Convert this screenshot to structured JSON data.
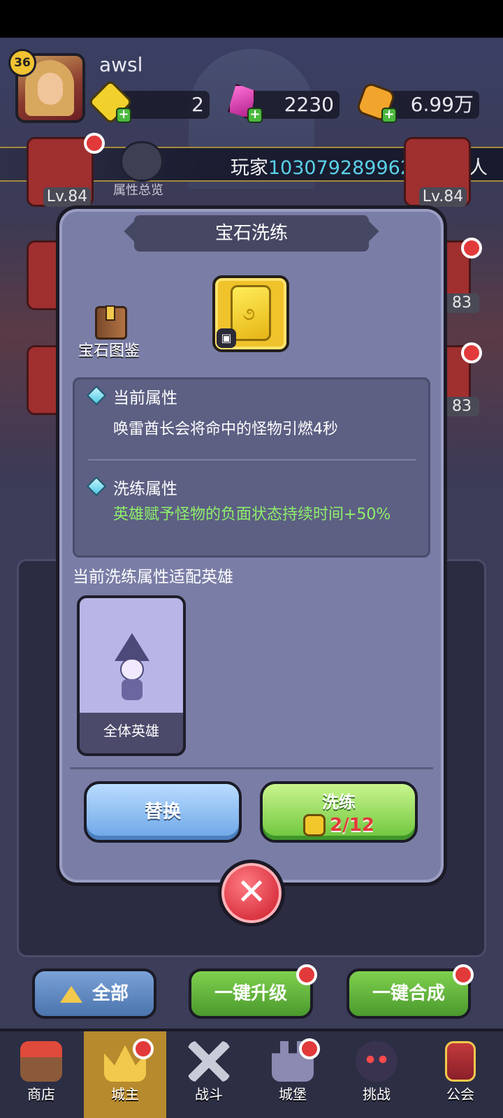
{
  "player": {
    "level": "36",
    "name": "awsl"
  },
  "resources": [
    {
      "icon": "yellow-gem-icon",
      "value": "2"
    },
    {
      "icon": "pink-crystal-icon",
      "value": "2230"
    },
    {
      "icon": "gold-coin-icon",
      "value": "6.99万"
    }
  ],
  "banner": {
    "prefix": "玩家",
    "highlight": "103079289962",
    "suffix": "气运惊人"
  },
  "slots": {
    "left_top_level": "Lv.84",
    "right_top_level": "Lv.84",
    "right_mid_level": "83",
    "right_low_level": "83"
  },
  "attr_overview_label": "属性总览",
  "modal": {
    "title": "宝石洗练",
    "codex_label": "宝石图鉴",
    "current_attr_title": "当前属性",
    "current_attr_text": "唤雷酋长会将命中的怪物引燃4秒",
    "refine_attr_title": "洗练属性",
    "refine_attr_text": "英雄赋予怪物的负面状态持续时间+50%",
    "fit_heroes_title": "当前洗练属性适配英雄",
    "hero_card_name": "全体英雄",
    "replace_label": "替换",
    "refine_label": "洗练",
    "refine_cost": "2/12"
  },
  "bottom_buttons": {
    "all": "全部",
    "upgrade": "一键升级",
    "merge": "一键合成"
  },
  "nav": [
    {
      "label": "商店",
      "icon": "shop-icon"
    },
    {
      "label": "城主",
      "icon": "crown-icon"
    },
    {
      "label": "战斗",
      "icon": "swords-icon"
    },
    {
      "label": "城堡",
      "icon": "castle-icon"
    },
    {
      "label": "挑战",
      "icon": "demon-icon"
    },
    {
      "label": "公会",
      "icon": "guild-banner-icon"
    }
  ],
  "colors": {
    "accent_green": "#8ef06b",
    "banner_highlight": "#5ad1e8",
    "cost_red": "#e23a3a"
  }
}
